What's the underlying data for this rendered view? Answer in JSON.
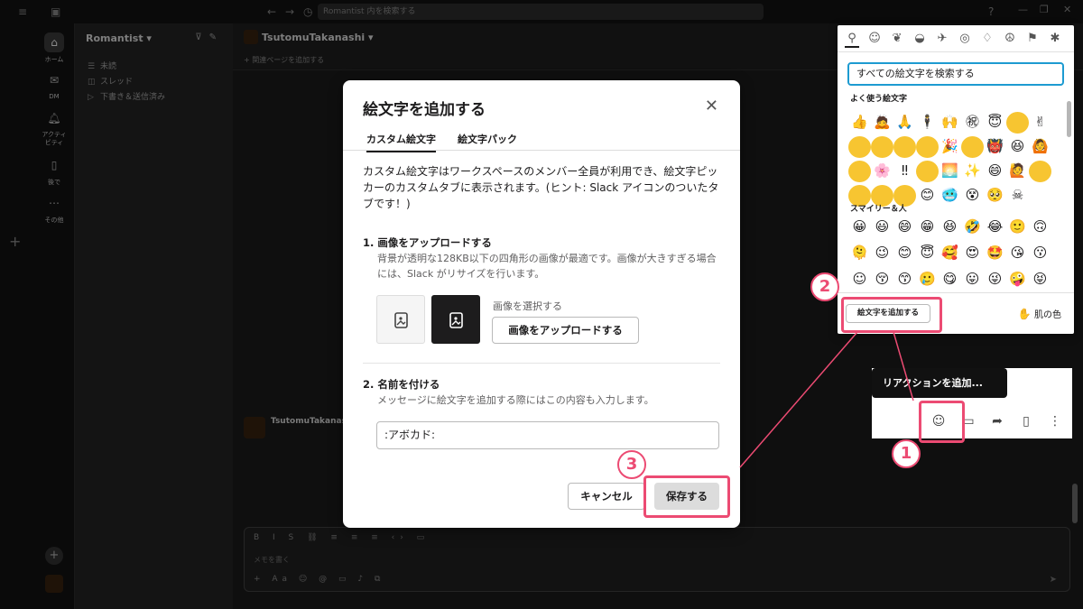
{
  "topbar": {
    "search_placeholder": "Romantist 内を検索する"
  },
  "rail": {
    "items": [
      {
        "label": "ホーム",
        "icon": "home-icon"
      },
      {
        "label": "DM",
        "icon": "dm-icon"
      },
      {
        "label": "アクティビティ",
        "icon": "bell-icon"
      },
      {
        "label": "後で",
        "icon": "bookmark-icon"
      },
      {
        "label": "その他",
        "icon": "more-icon"
      }
    ]
  },
  "sidebar": {
    "workspace": "Romantist",
    "rows": [
      {
        "label": "未読"
      },
      {
        "label": "スレッド"
      },
      {
        "label": "下書き＆送信済み"
      }
    ]
  },
  "channel": {
    "name": "TsutomuTakanashi",
    "bookmark": "+ 関連ページを追加する",
    "message_author": "TsutomuTakanashi",
    "composer_placeholder": "メモを書く"
  },
  "modal": {
    "title": "絵文字を追加する",
    "tabs": [
      "カスタム絵文字",
      "絵文字パック"
    ],
    "intro": "カスタム絵文字はワークスペースのメンバー全員が利用でき、絵文字ピッカーのカスタムタブに表示されます。(ヒント: Slack アイコンのついたタブです！)",
    "step1": {
      "title": "1. 画像をアップロードする",
      "desc": "背景が透明な128KB以下の四角形の画像が最適です。画像が大きすぎる場合には、Slack がリサイズを行います。",
      "choose_label": "画像を選択する",
      "upload_button": "画像をアップロードする"
    },
    "step2": {
      "title": "2. 名前を付ける",
      "desc": "メッセージに絵文字を追加する際にはこの内容も入力します。",
      "input_value": ":アボカド:"
    },
    "cancel_button": "キャンセル",
    "save_button": "保存する"
  },
  "picker": {
    "search_placeholder": "すべての絵文字を検索する",
    "frequent_title": "よく使う絵文字",
    "frequent": [
      "👍",
      "🙇",
      "🙏",
      "🕴",
      "🙌",
      "㊗",
      "😇",
      "",
      "✌",
      "",
      "",
      "",
      "",
      "🎉",
      "",
      "👹",
      "😆",
      "🙆",
      "",
      "🌸",
      "‼",
      "",
      "🌅",
      "✨",
      "😄",
      "🙋",
      "",
      "",
      "",
      "",
      "😊",
      "🥶",
      "😵",
      "🥺",
      "☠"
    ],
    "smileys_title": "スマイリー＆人",
    "smileys": [
      "😀",
      "😃",
      "😄",
      "😁",
      "😆",
      "🤣",
      "😂",
      "🙂",
      "🙃",
      "🫠",
      "😉",
      "😊",
      "😇",
      "🥰",
      "😍",
      "🤩",
      "😘",
      "😗",
      "☺",
      "😚",
      "😙",
      "🥲",
      "😋",
      "😛",
      "😜",
      "🤪",
      "😝"
    ],
    "add_emoji_button": "絵文字を追加する",
    "skin_tone_label": "肌の色"
  },
  "hover": {
    "tooltip": "リアクションを追加...",
    "icons": [
      "add-reaction-icon",
      "reply-thread-icon",
      "forward-icon",
      "bookmark-icon",
      "more-vertical-icon"
    ]
  },
  "annotations": {
    "n1": "1",
    "n2": "2",
    "n3": "3",
    "color": "#ec4b73"
  }
}
